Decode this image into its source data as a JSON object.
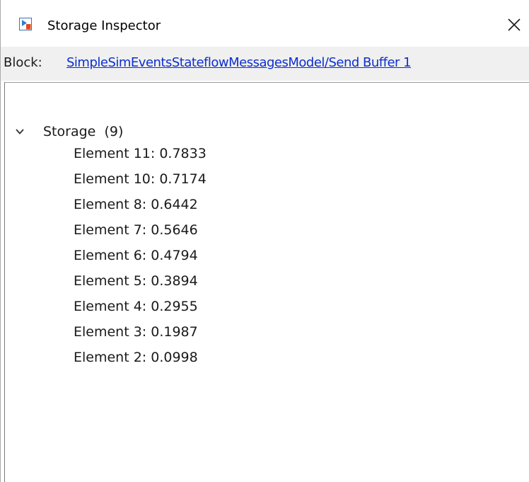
{
  "window": {
    "title": "Storage Inspector",
    "icon": "simulink-model-icon",
    "close_icon": "close-icon"
  },
  "block": {
    "label": "Block:",
    "path": "SimpleSimEventsStateflowMessagesModel/Send Buffer 1"
  },
  "tree": {
    "node": {
      "label": "Storage",
      "count": "(9)",
      "expanded": true,
      "icon": "chevron-down-icon"
    },
    "elements": [
      "Element 11: 0.7833",
      "Element 10: 0.7174",
      "Element 8: 0.6442",
      "Element 7: 0.5646",
      "Element 6: 0.4794",
      "Element 5: 0.3894",
      "Element 4: 0.2955",
      "Element 3: 0.1987",
      "Element 2: 0.0998"
    ]
  },
  "colors": {
    "link": "#0b2fcf",
    "block_row_bg": "#f0f0f0",
    "window_bg": "#ffffff"
  }
}
